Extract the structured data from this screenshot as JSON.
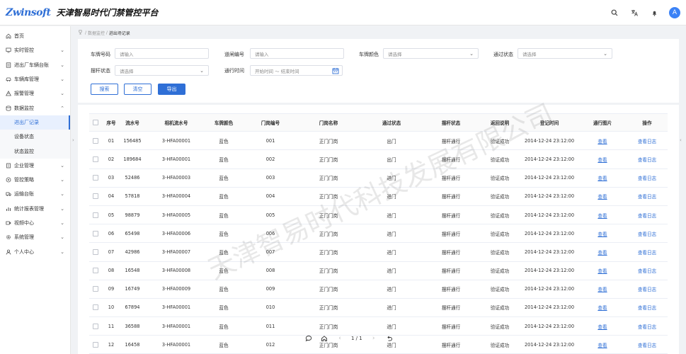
{
  "header": {
    "logo_text": "Zwinsoft",
    "app_title": "天津智易时代门禁管控平台",
    "avatar_letter": "A",
    "icons": [
      "search-icon",
      "translate-icon",
      "bell-icon"
    ]
  },
  "sidebar": {
    "items": [
      {
        "label": "首页",
        "icon": "home-icon"
      },
      {
        "label": "实时管控",
        "icon": "monitor-icon"
      },
      {
        "label": "进出厂车辆台账",
        "icon": "ledger-icon"
      },
      {
        "label": "车辆库管理",
        "icon": "car-icon"
      },
      {
        "label": "报警管理",
        "icon": "alarm-icon"
      },
      {
        "label": "数据监控",
        "icon": "data-icon"
      },
      {
        "label": "进出厂记录",
        "icon": ""
      },
      {
        "label": "设备状态",
        "icon": ""
      },
      {
        "label": "状态监控",
        "icon": ""
      },
      {
        "label": "企业管理",
        "icon": "building-icon"
      },
      {
        "label": "管控策略",
        "icon": "strategy-icon"
      },
      {
        "label": "运输台账",
        "icon": "truck-icon"
      },
      {
        "label": "统计报表管理",
        "icon": "chart-icon"
      },
      {
        "label": "视频中心",
        "icon": "video-icon"
      },
      {
        "label": "系统管理",
        "icon": "settings-icon"
      },
      {
        "label": "个人中心",
        "icon": "user-icon"
      }
    ]
  },
  "breadcrumb": {
    "parent": "数据监控",
    "current": "进出场记录"
  },
  "search": {
    "plate_label": "车牌号码",
    "plate_placeholder": "请输入",
    "gate_label": "道闸编号",
    "gate_placeholder": "请输入",
    "color_label": "车牌颜色",
    "color_placeholder": "请选择",
    "pass_label": "通过状态",
    "pass_placeholder": "请选择",
    "bar_label": "摆杆状态",
    "bar_placeholder": "请选择",
    "time_label": "通行时间",
    "time_placeholder": "开始时间 ～ 结束时间",
    "search_btn": "搜索",
    "clear_btn": "清空",
    "export_btn": "导出"
  },
  "table": {
    "headers": [
      "序号",
      "流水号",
      "相机流水号",
      "车牌颜色",
      "门岗编号",
      "门岗名称",
      "通过状态",
      "摆杆状态",
      "返回说明",
      "登记时间",
      "通行图片",
      "操作"
    ],
    "rows": [
      {
        "no": "01",
        "serial": "156485",
        "cam": "3-HFA00001",
        "color": "蓝色",
        "gate": "001",
        "gate_name": "正门门岗",
        "pass": "出门",
        "bar": "摆杆通行",
        "ret": "验证成功",
        "time": "2014-12-24  23:12:00",
        "img": "查看",
        "op": "查看日志"
      },
      {
        "no": "02",
        "serial": "189684",
        "cam": "3-HFA00001",
        "color": "蓝色",
        "gate": "002",
        "gate_name": "正门门岗",
        "pass": "出门",
        "bar": "摆杆通行",
        "ret": "验证成功",
        "time": "2014-12-24  23:12:00",
        "img": "查看",
        "op": "查看日志"
      },
      {
        "no": "03",
        "serial": "52486",
        "cam": "3-HFA00003",
        "color": "蓝色",
        "gate": "003",
        "gate_name": "正门门岗",
        "pass": "进门",
        "bar": "摆杆通行",
        "ret": "验证成功",
        "time": "2014-12-24  23:12:00",
        "img": "查看",
        "op": "查看日志"
      },
      {
        "no": "04",
        "serial": "57818",
        "cam": "3-HFA00004",
        "color": "蓝色",
        "gate": "004",
        "gate_name": "正门门岗",
        "pass": "进门",
        "bar": "摆杆通行",
        "ret": "验证成功",
        "time": "2014-12-24  23:12:00",
        "img": "查看",
        "op": "查看日志"
      },
      {
        "no": "05",
        "serial": "98879",
        "cam": "3-HFA00005",
        "color": "蓝色",
        "gate": "005",
        "gate_name": "正门门岗",
        "pass": "进门",
        "bar": "摆杆通行",
        "ret": "验证成功",
        "time": "2014-12-24  23:12:00",
        "img": "查看",
        "op": "查看日志"
      },
      {
        "no": "06",
        "serial": "65498",
        "cam": "3-HFA00006",
        "color": "蓝色",
        "gate": "006",
        "gate_name": "正门门岗",
        "pass": "进门",
        "bar": "摆杆通行",
        "ret": "验证成功",
        "time": "2014-12-24  23:12:00",
        "img": "查看",
        "op": "查看日志"
      },
      {
        "no": "07",
        "serial": "42986",
        "cam": "3-HFA00007",
        "color": "蓝色",
        "gate": "007",
        "gate_name": "正门门岗",
        "pass": "进门",
        "bar": "摆杆通行",
        "ret": "验证成功",
        "time": "2014-12-24  23:12:00",
        "img": "查看",
        "op": "查看日志"
      },
      {
        "no": "08",
        "serial": "16548",
        "cam": "3-HFA00008",
        "color": "蓝色",
        "gate": "008",
        "gate_name": "正门门岗",
        "pass": "进门",
        "bar": "摆杆通行",
        "ret": "验证成功",
        "time": "2014-12-24  23:12:00",
        "img": "查看",
        "op": "查看日志"
      },
      {
        "no": "09",
        "serial": "16749",
        "cam": "3-HFA00009",
        "color": "蓝色",
        "gate": "009",
        "gate_name": "正门门岗",
        "pass": "进门",
        "bar": "摆杆通行",
        "ret": "验证成功",
        "time": "2014-12-24  23:12:00",
        "img": "查看",
        "op": "查看日志"
      },
      {
        "no": "10",
        "serial": "67894",
        "cam": "3-HFA00001",
        "color": "蓝色",
        "gate": "010",
        "gate_name": "正门门岗",
        "pass": "进门",
        "bar": "摆杆通行",
        "ret": "验证成功",
        "time": "2014-12-24  23:12:00",
        "img": "查看",
        "op": "查看日志"
      },
      {
        "no": "11",
        "serial": "36588",
        "cam": "3-HFA00001",
        "color": "蓝色",
        "gate": "011",
        "gate_name": "正门门岗",
        "pass": "进门",
        "bar": "摆杆通行",
        "ret": "验证成功",
        "time": "2014-12-24  23:12:00",
        "img": "查看",
        "op": "查看日志"
      },
      {
        "no": "12",
        "serial": "16458",
        "cam": "3-HFA00001",
        "color": "蓝色",
        "gate": "012",
        "gate_name": "正门门岗",
        "pass": "进门",
        "bar": "摆杆通行",
        "ret": "验证成功",
        "time": "2014-12-24  23:12:00",
        "img": "查看",
        "op": "查看日志"
      }
    ]
  },
  "watermark": "天津智易时代科技发展有限公司",
  "pager": {
    "page_text": "1 / 1"
  },
  "colors": {
    "primary": "#2f6fd6",
    "header_bg": "#ffffff",
    "page_bg": "#f0f2f5"
  }
}
